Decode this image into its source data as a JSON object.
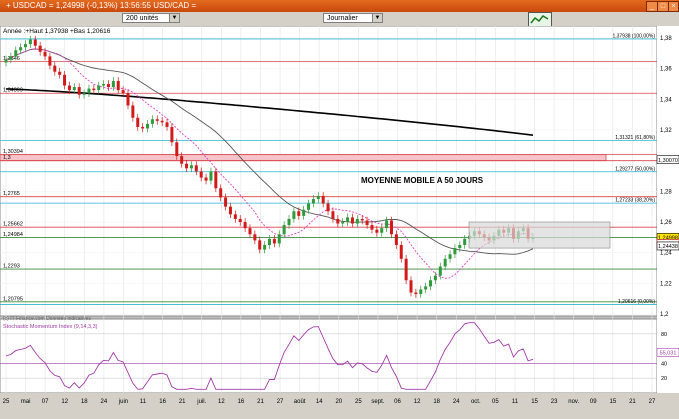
{
  "window": {
    "title": "+ USDCAD = 1,24998 (-0,13%) 13:56:55 USD/CAD =",
    "buttons": [
      "_",
      "□",
      "×"
    ]
  },
  "toolbar": {
    "units": "200 unités",
    "period": "Journalier"
  },
  "info_line": "Année :+Haut 1,37938 +Bas 1,20616",
  "annotation": "MOYENNE MOBILE A 50 JOURS",
  "watermark": "(c) IT-Finance.com Données indicatives",
  "indicator_label": "Stochastic Momentum Index (9,14,3,3)",
  "colors": {
    "accent": "#e36b1f",
    "up_candle": "#2e9a3a",
    "down_candle": "#d11a1a",
    "ma200": "#000000",
    "ma50": "#555555",
    "ma20": "#e040c8",
    "fib_line": "#2bb5cf",
    "resistance": "#d9424a",
    "support": "#3a8a3a",
    "indicator": "#a23aa8"
  },
  "chart_data": {
    "type": "candlestick",
    "y_range": [
      1.2,
      1.38
    ],
    "y_ticks": [
      "1,38",
      "1,36",
      "1,34",
      "1,32",
      "1,3",
      "1,28",
      "1,26",
      "1,24",
      "1,22",
      "1,2"
    ],
    "x_ticks": [
      "25",
      "mai",
      "07",
      "12",
      "18",
      "24",
      "juin",
      "11",
      "16",
      "21",
      "juil.",
      "12",
      "16",
      "21",
      "27",
      "août",
      "14",
      "20",
      "25",
      "sept.",
      "06",
      "12",
      "18",
      "24",
      "oct.",
      "05",
      "11",
      "15",
      "23",
      "nov.",
      "09",
      "15",
      "21",
      "27"
    ],
    "left_labels": [
      {
        "text": "1,3646",
        "value": 1.3646
      },
      {
        "text": "1,34399",
        "value": 1.34399
      },
      {
        "text": "1,30394",
        "value": 1.30394
      },
      {
        "text": "1,3",
        "value": 1.3
      },
      {
        "text": "1,2765",
        "value": 1.2765
      },
      {
        "text": "1,25662",
        "value": 1.25662
      },
      {
        "text": "1,24984",
        "value": 1.24984
      },
      {
        "text": "1,2293",
        "value": 1.2293
      },
      {
        "text": "1,20795",
        "value": 1.20795
      }
    ],
    "fib_levels": [
      {
        "label": "1,37938 (100,00%)",
        "value": 1.37938
      },
      {
        "label": "1,31321 (61,80%)",
        "value": 1.31321
      },
      {
        "label": "1,29277 (50,00%)",
        "value": 1.29277
      },
      {
        "label": "1,27233 (38,20%)",
        "value": 1.27233
      },
      {
        "label": "1,20616 (0,00%)",
        "value": 1.20616
      }
    ],
    "right_boxes": [
      {
        "label": "1,30070",
        "value": 1.3007,
        "style": "black"
      },
      {
        "label": "1,24998",
        "value": 1.24998,
        "style": "yellow"
      },
      {
        "label": "-0,13%",
        "value": 1.24598,
        "style": "red"
      },
      {
        "label": "1,24438",
        "value": 1.24438,
        "style": "black"
      }
    ],
    "indicator": {
      "y_ticks": [
        "80",
        "40",
        "20"
      ],
      "value_label": "55,031",
      "value": 55.031
    },
    "closes": [
      1.366,
      1.368,
      1.372,
      1.374,
      1.376,
      1.379,
      1.375,
      1.371,
      1.368,
      1.362,
      1.358,
      1.356,
      1.349,
      1.346,
      1.348,
      1.343,
      1.344,
      1.347,
      1.346,
      1.349,
      1.35,
      1.348,
      1.352,
      1.346,
      1.344,
      1.336,
      1.328,
      1.322,
      1.321,
      1.324,
      1.327,
      1.326,
      1.325,
      1.322,
      1.312,
      1.303,
      1.298,
      1.295,
      1.297,
      1.293,
      1.289,
      1.287,
      1.293,
      1.282,
      1.276,
      1.27,
      1.265,
      1.262,
      1.26,
      1.256,
      1.252,
      1.248,
      1.242,
      1.245,
      1.249,
      1.246,
      1.252,
      1.258,
      1.262,
      1.267,
      1.264,
      1.268,
      1.272,
      1.275,
      1.277,
      1.272,
      1.267,
      1.262,
      1.259,
      1.26,
      1.263,
      1.259,
      1.262,
      1.261,
      1.258,
      1.255,
      1.253,
      1.256,
      1.261,
      1.252,
      1.245,
      1.236,
      1.222,
      1.214,
      1.213,
      1.216,
      1.218,
      1.222,
      1.225,
      1.231,
      1.236,
      1.239,
      1.243,
      1.245,
      1.249,
      1.251,
      1.254,
      1.252,
      1.25,
      1.248,
      1.251,
      1.255,
      1.253,
      1.256,
      1.249,
      1.254,
      1.256,
      1.249,
      1.25
    ]
  }
}
